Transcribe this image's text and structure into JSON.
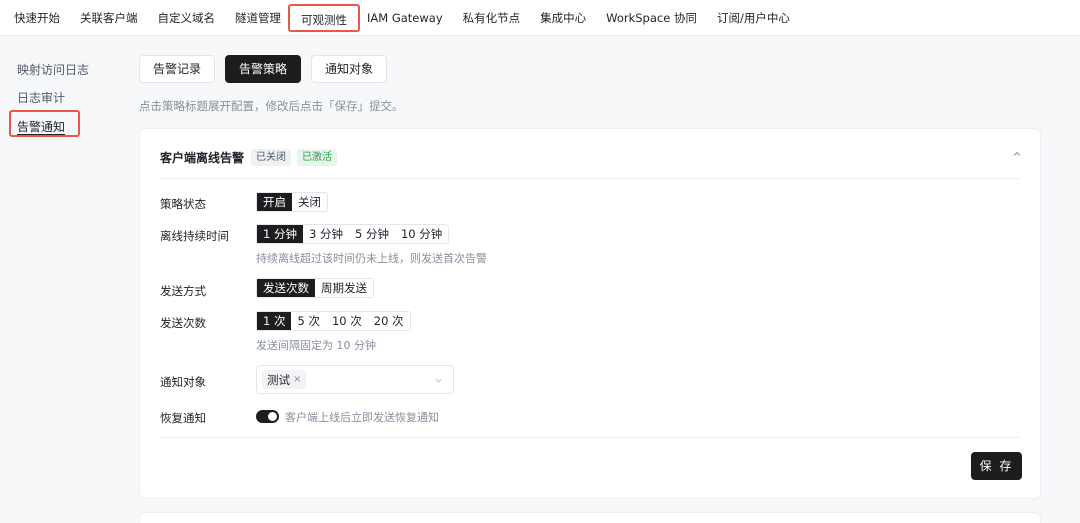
{
  "topnav": {
    "items": [
      {
        "label": "快速开始"
      },
      {
        "label": "关联客户端"
      },
      {
        "label": "自定义域名"
      },
      {
        "label": "隧道管理"
      },
      {
        "label": "可观测性"
      },
      {
        "label": "IAM Gateway"
      },
      {
        "label": "私有化节点"
      },
      {
        "label": "集成中心"
      },
      {
        "label": "WorkSpace 协同"
      },
      {
        "label": "订阅/用户中心"
      }
    ],
    "active_index": 4
  },
  "sidebar": {
    "items": [
      {
        "label": "映射访问日志"
      },
      {
        "label": "日志审计"
      },
      {
        "label": "告警通知"
      }
    ],
    "active_index": 2
  },
  "tabs": [
    {
      "label": "告警记录"
    },
    {
      "label": "告警策略"
    },
    {
      "label": "通知对象"
    }
  ],
  "hint": "点击策略标题展开配置，修改后点击「保存」提交。",
  "policy": {
    "title": "客户端离线告警",
    "badges": [
      "已关闭",
      "已激活"
    ],
    "status": {
      "label": "策略状态",
      "options": [
        "开启",
        "关闭"
      ],
      "selected": "开启"
    },
    "offline_duration": {
      "label": "离线持续时间",
      "options": [
        "1 分钟",
        "3 分钟",
        "5 分钟",
        "10 分钟"
      ],
      "selected": "1 分钟",
      "help": "持续离线超过该时间仍未上线，则发送首次告警"
    },
    "send_mode": {
      "label": "发送方式",
      "options": [
        "发送次数",
        "周期发送"
      ],
      "selected": "发送次数"
    },
    "send_count": {
      "label": "发送次数",
      "options": [
        "1 次",
        "5 次",
        "10 次",
        "20 次"
      ],
      "selected": "1 次",
      "help": "发送间隔固定为 10 分钟"
    },
    "notify_target": {
      "label": "通知对象",
      "tags": [
        "测试"
      ]
    },
    "recovery": {
      "label": "恢复通知",
      "enabled": true,
      "text": "客户端上线后立即发送恢复通知"
    },
    "save_label": "保 存"
  },
  "colors": {
    "accent": "#1d1d1f",
    "highlight": "#e8574a",
    "badge_green": "#2e9d4b"
  }
}
